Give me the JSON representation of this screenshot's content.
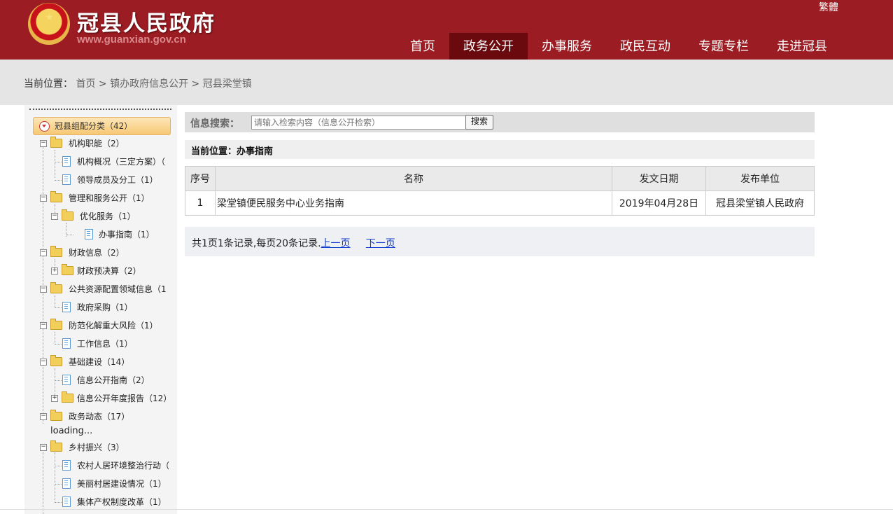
{
  "header": {
    "site_title": "冠县人民政府",
    "site_url": "www.guanxian.gov.cn",
    "trad_link": "繁體",
    "nav": [
      "首页",
      "政务公开",
      "办事服务",
      "政民互动",
      "专题专栏",
      "走进冠县"
    ],
    "active_nav": "政务公开"
  },
  "breadcrumb": {
    "label": "当前位置：",
    "items": [
      "首页",
      "镇办政府信息公开",
      "冠县梁堂镇"
    ],
    "sep": ">"
  },
  "sidebar": {
    "root": "冠县组配分类（42）",
    "nodes": [
      "机构职能（2）",
      "机构概况（三定方案）（",
      "领导成员及分工（1）",
      "管理和服务公开（1）",
      "优化服务（1）",
      "办事指南（1）",
      "财政信息（2）",
      "财政预决算（2）",
      "公共资源配置领域信息（1",
      "政府采购（1）",
      "防范化解重大风险（1）",
      "工作信息（1）",
      "基础建设（14）",
      "信息公开指南（2）",
      "信息公开年度报告（12）",
      "政务动态（17）",
      "乡村振兴（3）",
      "农村人居环境整治行动（",
      "美丽村居建设情况（1）",
      "集体产权制度改革（1）"
    ],
    "loading": "loading..."
  },
  "search": {
    "label": "信息搜索：",
    "placeholder": "请输入检索内容（信息公开检索）",
    "button": "搜索"
  },
  "current": {
    "text": "当前位置：办事指南"
  },
  "table": {
    "headers": [
      "序号",
      "名称",
      "发文日期",
      "发布单位"
    ],
    "rows": [
      [
        "1",
        "梁堂镇便民服务中心业务指南",
        "2019年04月28日",
        "冠县梁堂镇人民政府"
      ]
    ]
  },
  "pager": {
    "summary": "共1页1条记录,每页20条记录.",
    "prev": "上一页",
    "next": "下一页"
  }
}
